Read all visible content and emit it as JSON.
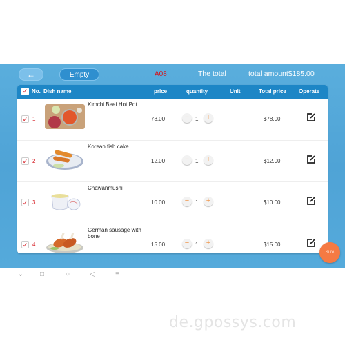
{
  "header": {
    "back_icon": "arrow-left-icon",
    "back_glyph": "←",
    "empty_label": "Empty",
    "table_number": "A08",
    "total_label": "The total",
    "total_amount": "total amount$185.00",
    "table_number_color": "#d4141b"
  },
  "table": {
    "header_check": "✓",
    "columns": [
      "No.",
      "Dish name",
      "price",
      "quantity",
      "Unit",
      "Total price",
      "Operate"
    ],
    "rows": [
      {
        "checked": "✓",
        "no": "1",
        "dish": "Kimchi Beef Hot Pot",
        "price": "78.00",
        "minus": "−",
        "qty": "1",
        "plus": "+",
        "unit": "",
        "total": "$78.00",
        "image": "kimchi-beef-hot-pot-photo"
      },
      {
        "checked": "✓",
        "no": "2",
        "dish": "Korean fish cake",
        "price": "12.00",
        "minus": "−",
        "qty": "1",
        "plus": "+",
        "unit": "",
        "total": "$12.00",
        "image": "korean-fish-cake-photo"
      },
      {
        "checked": "✓",
        "no": "3",
        "dish": "Chawanmushi",
        "price": "10.00",
        "minus": "−",
        "qty": "1",
        "plus": "+",
        "unit": "",
        "total": "$10.00",
        "image": "chawanmushi-photo"
      },
      {
        "checked": "✓",
        "no": "4",
        "dish": "German sausage with bone",
        "price": "15.00",
        "minus": "−",
        "qty": "1",
        "plus": "+",
        "unit": "",
        "total": "$15.00",
        "image": "german-sausage-photo"
      }
    ]
  },
  "sure_label": "Sure",
  "sure_color": "#f57a43",
  "accent_color": "#1d86c6",
  "nav": {
    "items": [
      {
        "icon": "chevron-down-icon",
        "glyph": "⌄"
      },
      {
        "icon": "recent-apps-icon",
        "glyph": "□"
      },
      {
        "icon": "home-icon",
        "glyph": "○"
      },
      {
        "icon": "back-triangle-icon",
        "glyph": "◁"
      },
      {
        "icon": "notification-pull-icon",
        "glyph": "≡"
      }
    ]
  },
  "watermark": "de.gpossys.com"
}
